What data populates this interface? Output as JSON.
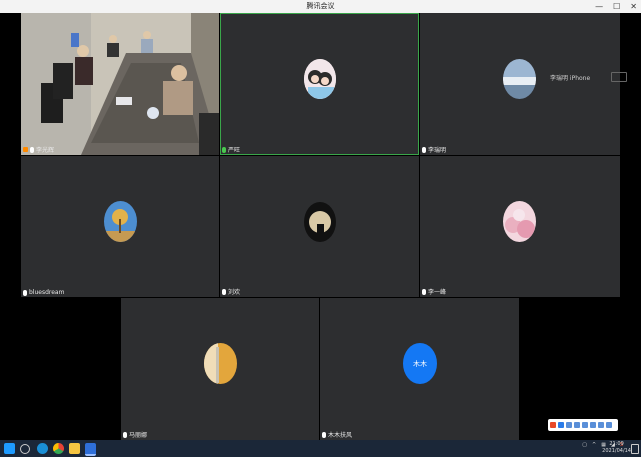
{
  "window": {
    "title": "腾讯会议"
  },
  "participants": [
    {
      "name": "李光辉",
      "role": "host",
      "video": "camera"
    },
    {
      "name": "严旺"
    },
    {
      "name": "李瑞明",
      "side_text": "李瑞明 iPhone"
    },
    {
      "name": "bluesdream"
    },
    {
      "name": "刘欢"
    },
    {
      "name": "李一峰"
    },
    {
      "name": "马丽娜"
    },
    {
      "name": "木木扶风",
      "avatar_text": "木木"
    }
  ],
  "taskbar": {
    "clock_time": "21:09",
    "clock_date": "2021/04/14"
  },
  "colors": {
    "active_speaker": "#3aa64a",
    "tile_bg": "#2d2e30",
    "taskbar": "#1b2738",
    "avatar_blue": "#1478f4"
  }
}
